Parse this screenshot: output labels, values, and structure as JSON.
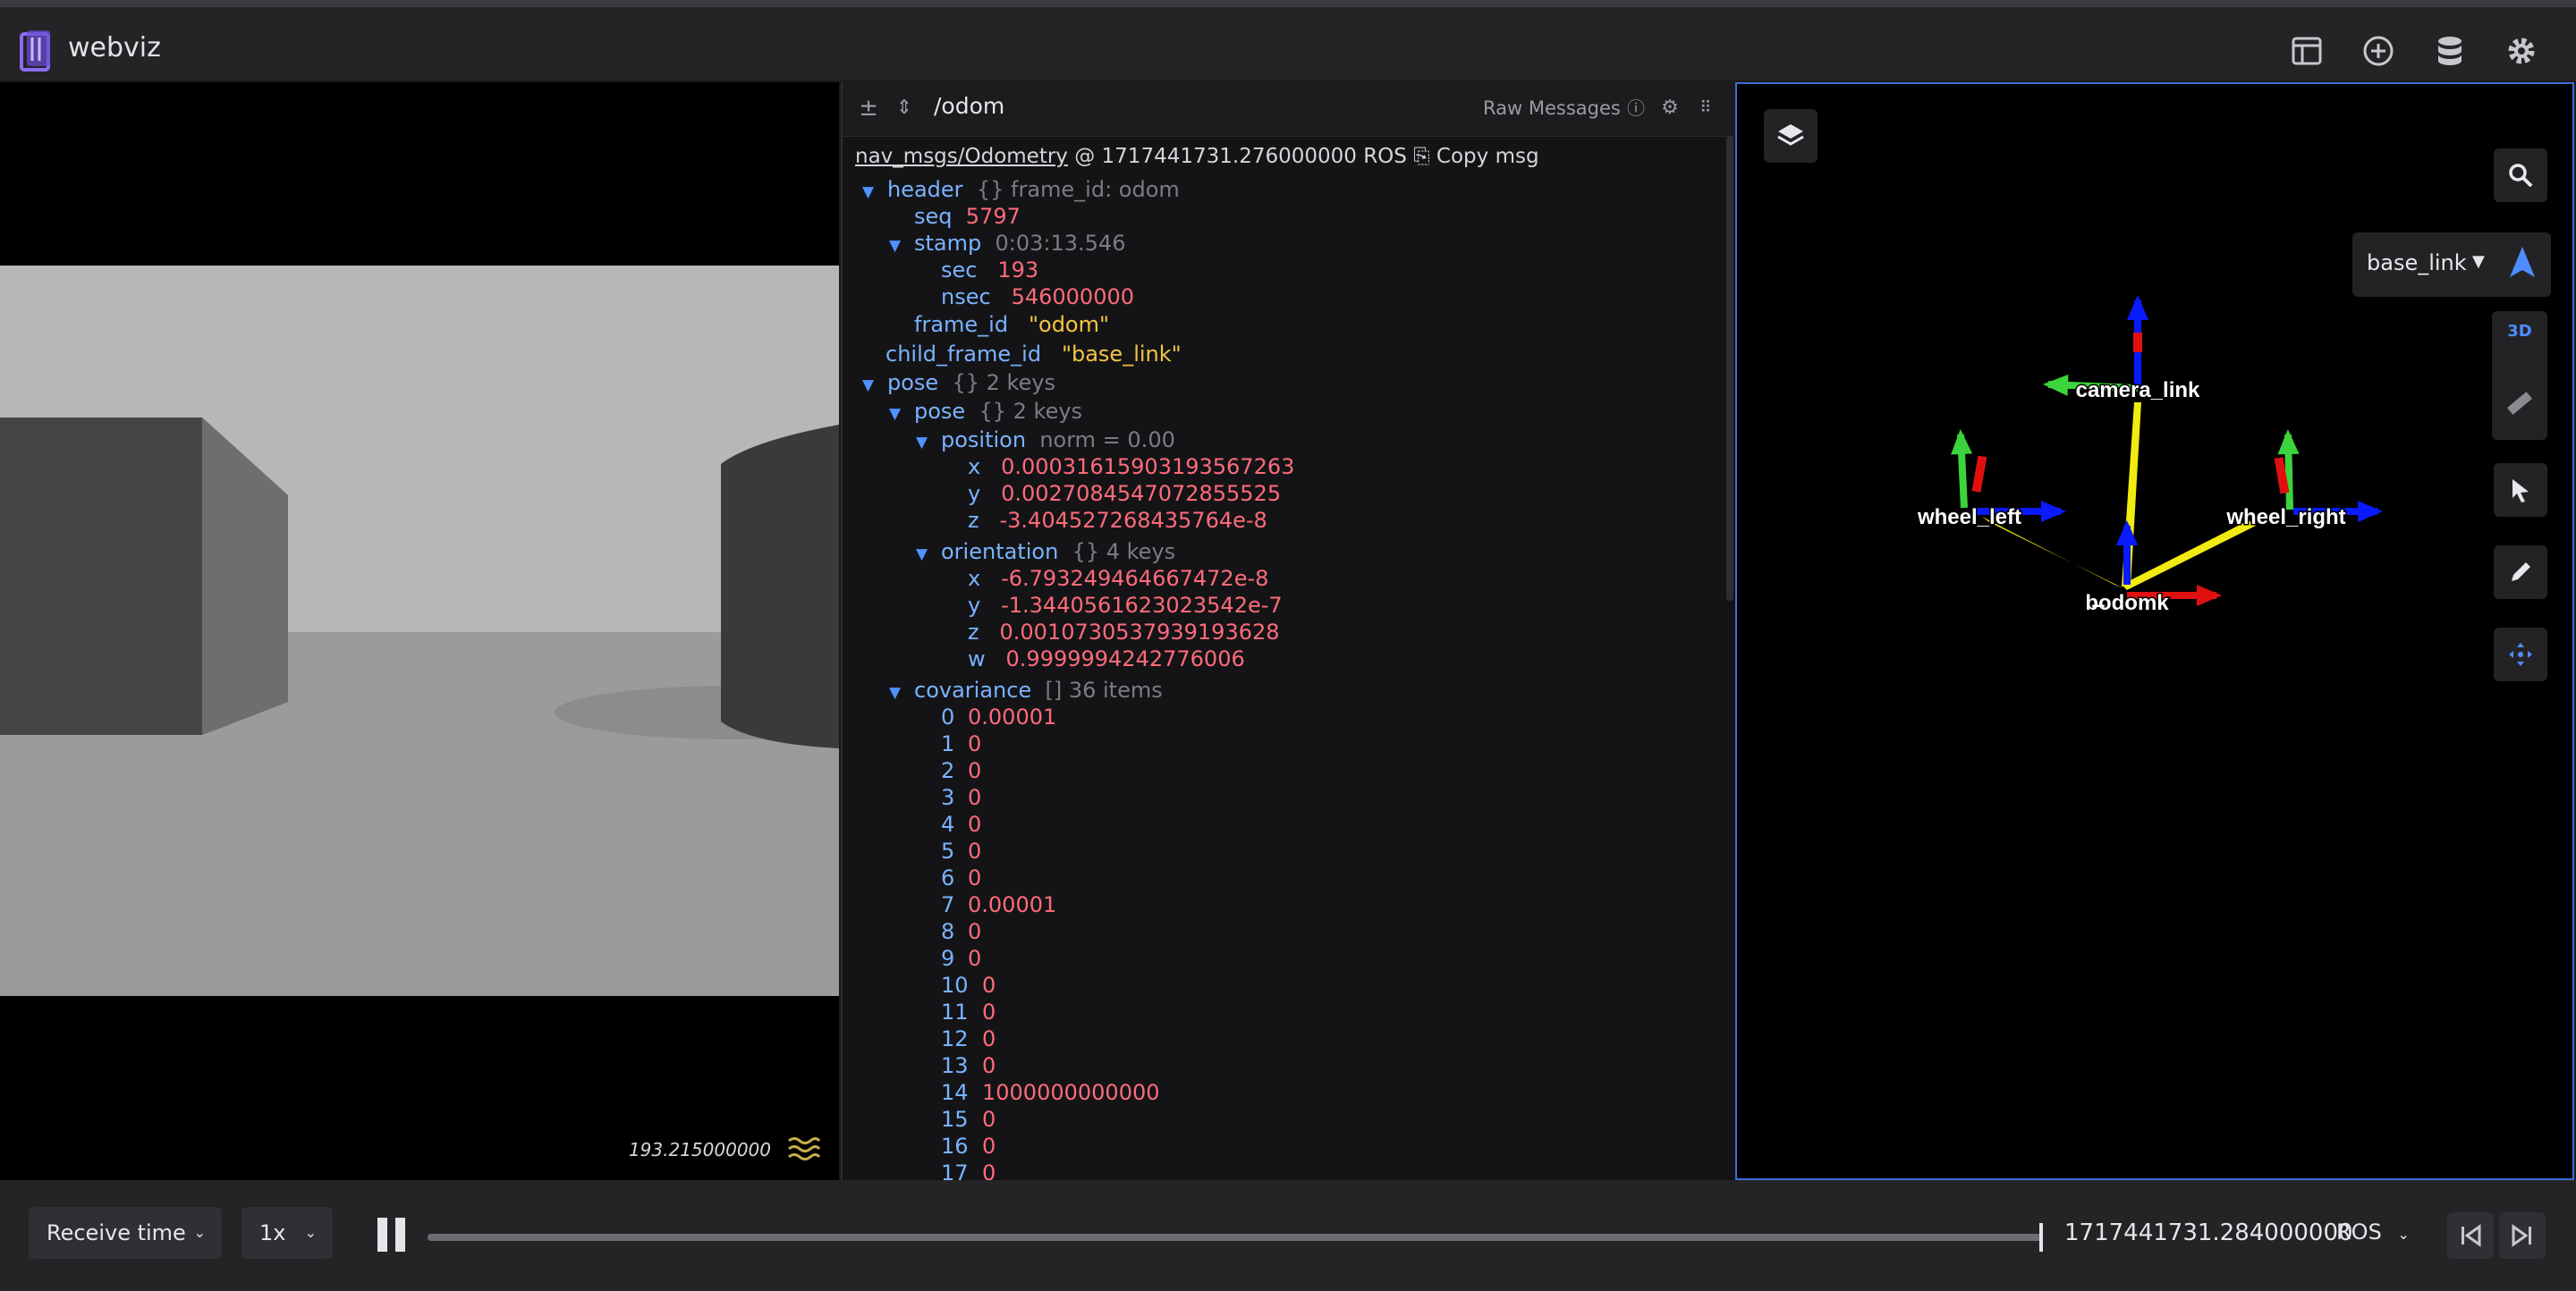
{
  "app": {
    "title": "webviz"
  },
  "image_panel": {
    "timestamp": "193.215000000"
  },
  "raw_messages": {
    "topic": "/odom",
    "panel_label": "Raw Messages",
    "message_type": "nav_msgs/Odometry",
    "receive_stamp": "@ 1717441731.276000000 ROS",
    "copy_label": "Copy msg",
    "tree": {
      "header": {
        "key": "header",
        "hint": "{} frame_id: odom"
      },
      "seq": {
        "key": "seq",
        "value": "5797"
      },
      "stamp": {
        "key": "stamp",
        "hint": "0:03:13.546"
      },
      "sec": {
        "key": "sec",
        "value": "193"
      },
      "nsec": {
        "key": "nsec",
        "value": "546000000"
      },
      "frame_id": {
        "key": "frame_id",
        "value": "\"odom\""
      },
      "child_frame_id": {
        "key": "child_frame_id",
        "value": "\"base_link\""
      },
      "pose_outer": {
        "key": "pose",
        "hint": "{} 2 keys"
      },
      "pose_inner": {
        "key": "pose",
        "hint": "{} 2 keys"
      },
      "position": {
        "key": "position",
        "hint": "norm = 0.00"
      },
      "px": {
        "key": "x",
        "value": "0.00031615903193567263"
      },
      "py": {
        "key": "y",
        "value": "0.0027084547072855525"
      },
      "pz": {
        "key": "z",
        "value": "-3.404527268435764e-8"
      },
      "orientation": {
        "key": "orientation",
        "hint": "{} 4 keys"
      },
      "ox": {
        "key": "x",
        "value": "-6.793249464667472e-8"
      },
      "oy": {
        "key": "y",
        "value": "-1.3440561623023542e-7"
      },
      "oz": {
        "key": "z",
        "value": "0.0010730537939193628"
      },
      "ow": {
        "key": "w",
        "value": "0.9999994242776006"
      },
      "covariance": {
        "key": "covariance",
        "hint": "[] 36 items"
      },
      "cov": [
        {
          "i": "0",
          "v": "0.00001"
        },
        {
          "i": "1",
          "v": "0"
        },
        {
          "i": "2",
          "v": "0"
        },
        {
          "i": "3",
          "v": "0"
        },
        {
          "i": "4",
          "v": "0"
        },
        {
          "i": "5",
          "v": "0"
        },
        {
          "i": "6",
          "v": "0"
        },
        {
          "i": "7",
          "v": "0.00001"
        },
        {
          "i": "8",
          "v": "0"
        },
        {
          "i": "9",
          "v": "0"
        },
        {
          "i": "10",
          "v": "0"
        },
        {
          "i": "11",
          "v": "0"
        },
        {
          "i": "12",
          "v": "0"
        },
        {
          "i": "13",
          "v": "0"
        },
        {
          "i": "14",
          "v": "1000000000000"
        },
        {
          "i": "15",
          "v": "0"
        },
        {
          "i": "16",
          "v": "0"
        },
        {
          "i": "17",
          "v": "0"
        }
      ]
    }
  },
  "three_d": {
    "follow_frame": "base_link",
    "view_mode": "3D",
    "frame_labels": {
      "camera": "camera_link",
      "wheel_left": "wheel_left",
      "wheel_right": "wheel_right",
      "base": "b̶odomk"
    },
    "colors": {
      "x_axis": "#e01010",
      "y_axis": "#3cd43c",
      "z_axis": "#0a1aff",
      "link": "#f0ec10"
    }
  },
  "playback": {
    "time_source": "Receive time",
    "speed": "1x",
    "current_time": "1717441731.284000000",
    "time_format": "ROS",
    "progress": 1.0
  },
  "colors": {
    "accent": "#3b6fd8",
    "number": "#ff6b7a",
    "string": "#f4c542",
    "key": "#7ab3ff"
  }
}
